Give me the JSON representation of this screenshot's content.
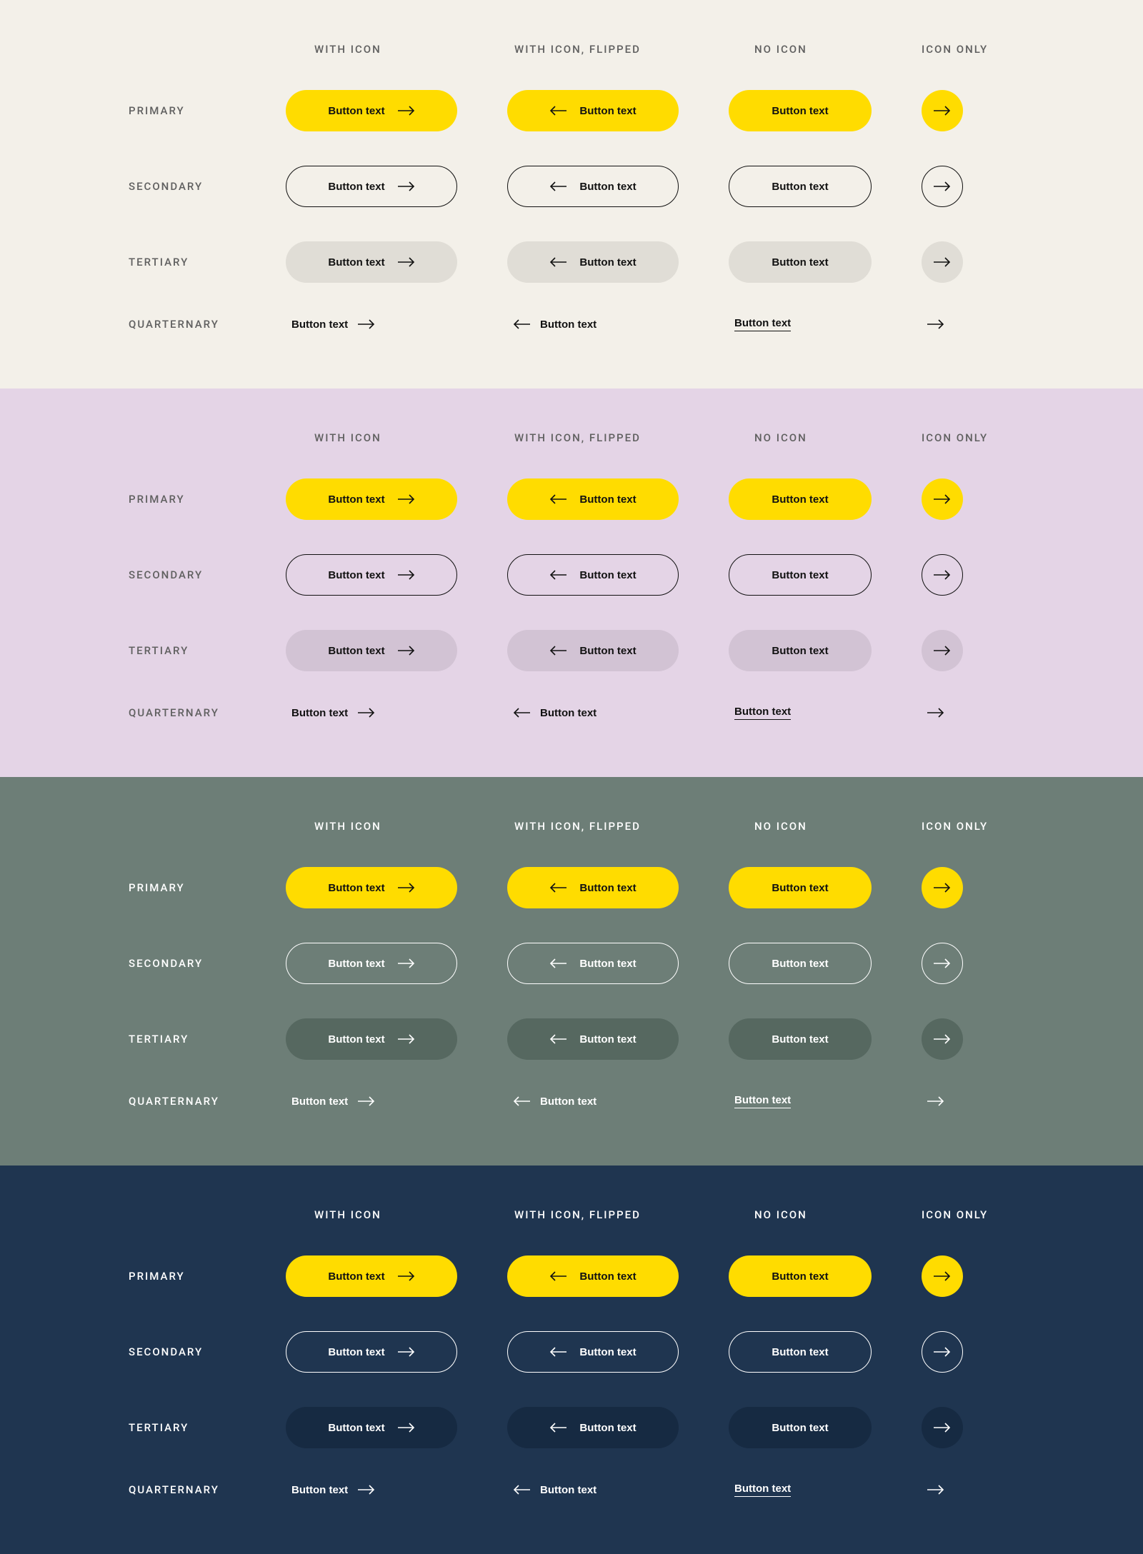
{
  "columns": [
    "WITH ICON",
    "WITH ICON, FLIPPED",
    "NO ICON",
    "ICON ONLY"
  ],
  "rows": [
    "PRIMARY",
    "SECONDARY",
    "TERTIARY",
    "QUARTERNARY"
  ],
  "button_label": "Button text",
  "sections": [
    {
      "id": "cream",
      "bg": "#f3f0e9"
    },
    {
      "id": "lilac",
      "bg": "#e4d4e6"
    },
    {
      "id": "sage",
      "bg": "#6d7e77"
    },
    {
      "id": "navy",
      "bg": "#1f3550"
    }
  ],
  "colors": {
    "primary_bg": "#ffdc00",
    "primary_text": "#111111"
  }
}
